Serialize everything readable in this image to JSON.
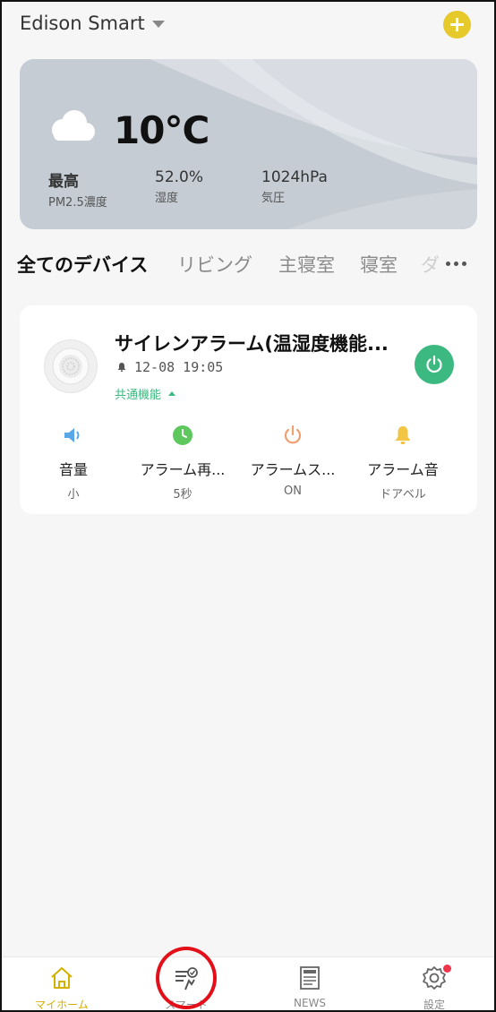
{
  "header": {
    "home_name": "Edison Smart",
    "add_icon": "plus-icon",
    "accent_color": "#e6c92b"
  },
  "weather": {
    "icon": "cloud-icon",
    "temperature": "10°C",
    "stats": [
      {
        "value": "最高",
        "label": "PM2.5濃度"
      },
      {
        "value": "52.0%",
        "label": "湿度"
      },
      {
        "value": "1024hPa",
        "label": "気圧"
      }
    ]
  },
  "tabs": {
    "items": [
      "全てのデバイス",
      "リビング",
      "主寝室",
      "寝室"
    ],
    "overflow_glyph": "ダ",
    "active": "全てのデバイス",
    "more_icon": "more-dots-icon"
  },
  "device": {
    "title": "サイレンアラーム(温湿度機能...",
    "time": "12-08 19:05",
    "common_functions_label": "共通機能",
    "power_color": "#3bb980",
    "functions": [
      {
        "name": "音量",
        "value": "小",
        "icon": "speaker-icon",
        "color": "#5aa7e8"
      },
      {
        "name": "アラーム再...",
        "value": "5秒",
        "icon": "clock-icon",
        "color": "#5ec85e"
      },
      {
        "name": "アラームス...",
        "value": "ON",
        "icon": "power-icon",
        "color": "#f0a070"
      },
      {
        "name": "アラーム音",
        "value": "ドアベル",
        "icon": "bell-icon",
        "color": "#f2c544"
      }
    ]
  },
  "nav": {
    "items": [
      {
        "label": "マイホーム",
        "icon": "home-icon"
      },
      {
        "label": "スマート",
        "icon": "smart-scene-icon"
      },
      {
        "label": "NEWS",
        "icon": "newspaper-icon"
      },
      {
        "label": "設定",
        "icon": "settings-icon"
      }
    ],
    "active_color": "#d4b000",
    "highlight_color": "#e3101a"
  }
}
